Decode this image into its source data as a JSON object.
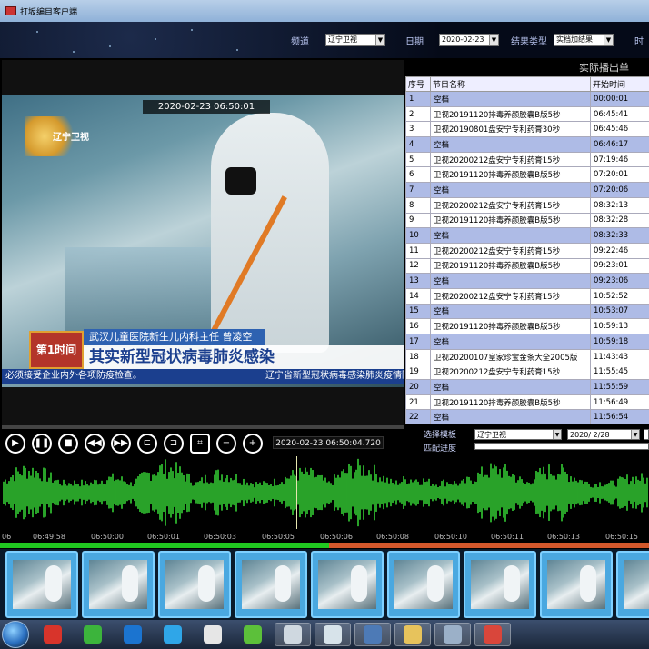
{
  "window": {
    "title": "打坂编目客户端"
  },
  "filters": {
    "channel_label": "频道",
    "channel_value": "辽宁卫视",
    "date_label": "日期",
    "date_value": "2020-02-23",
    "result_type_label": "结果类型",
    "result_type_value": "实档加结果",
    "time_label": "时"
  },
  "video": {
    "timestamp": "2020-02-23    06:50:01",
    "logo_text": "辽宁卫视",
    "badge_text": "第1时间",
    "name_bar": "武汉儿童医院新生儿内科主任  曾凌空",
    "headline": "其实新型冠状病毒肺炎感染",
    "ticker_left": "必须接受企业内外各项防疫检查。",
    "ticker_right": "辽宁省新型冠状病毒感染肺炎疫情防"
  },
  "controls": {
    "current_time": "2020-02-23  06:50:04.720",
    "buttons": [
      {
        "name": "play-button",
        "glyph": "▶"
      },
      {
        "name": "pause-button",
        "glyph": "❚❚"
      },
      {
        "name": "stop-button",
        "glyph": "■"
      },
      {
        "name": "rewind-button",
        "glyph": "◀◀"
      },
      {
        "name": "fast-forward-button",
        "glyph": "▶▶"
      },
      {
        "name": "mark-in-button",
        "glyph": "⊏"
      },
      {
        "name": "mark-out-button",
        "glyph": "⊐"
      },
      {
        "name": "crop-button",
        "glyph": "⌗"
      },
      {
        "name": "zoom-out-button",
        "glyph": "−"
      },
      {
        "name": "zoom-in-button",
        "glyph": "+"
      }
    ]
  },
  "playlist": {
    "title": "实际播出单",
    "headers": [
      "序号",
      "节目名称",
      "开始时间"
    ],
    "rows": [
      {
        "no": "1",
        "name": "空档",
        "start": "00:00:01",
        "blank": true
      },
      {
        "no": "2",
        "name": "卫视20191120排毒养颜胶囊B版5秒",
        "start": "06:45:41",
        "blank": false
      },
      {
        "no": "3",
        "name": "卫视20190801盘安宁专利药膏30秒",
        "start": "06:45:46",
        "blank": false
      },
      {
        "no": "4",
        "name": "空档",
        "start": "06:46:17",
        "blank": true
      },
      {
        "no": "5",
        "name": "卫视20200212盘安宁专利药膏15秒",
        "start": "07:19:46",
        "blank": false
      },
      {
        "no": "6",
        "name": "卫视20191120排毒养颜胶囊B版5秒",
        "start": "07:20:01",
        "blank": false
      },
      {
        "no": "7",
        "name": "空档",
        "start": "07:20:06",
        "blank": true
      },
      {
        "no": "8",
        "name": "卫视20200212盘安宁专利药膏15秒",
        "start": "08:32:13",
        "blank": false
      },
      {
        "no": "9",
        "name": "卫视20191120排毒养颜胶囊B版5秒",
        "start": "08:32:28",
        "blank": false
      },
      {
        "no": "10",
        "name": "空档",
        "start": "08:32:33",
        "blank": true
      },
      {
        "no": "11",
        "name": "卫视20200212盘安宁专利药膏15秒",
        "start": "09:22:46",
        "blank": false
      },
      {
        "no": "12",
        "name": "卫视20191120排毒养颜胶囊B版5秒",
        "start": "09:23:01",
        "blank": false
      },
      {
        "no": "13",
        "name": "空档",
        "start": "09:23:06",
        "blank": true
      },
      {
        "no": "14",
        "name": "卫视20200212盘安宁专利药膏15秒",
        "start": "10:52:52",
        "blank": false
      },
      {
        "no": "15",
        "name": "空档",
        "start": "10:53:07",
        "blank": true
      },
      {
        "no": "16",
        "name": "卫视20191120排毒养颜胶囊B版5秒",
        "start": "10:59:13",
        "blank": false
      },
      {
        "no": "17",
        "name": "空档",
        "start": "10:59:18",
        "blank": true
      },
      {
        "no": "18",
        "name": "卫视20200107皇家珍宝金条大全2005版",
        "start": "11:43:43",
        "blank": false
      },
      {
        "no": "19",
        "name": "卫视20200212盘安宁专利药膏15秒",
        "start": "11:55:45",
        "blank": false
      },
      {
        "no": "20",
        "name": "空档",
        "start": "11:55:59",
        "blank": true
      },
      {
        "no": "21",
        "name": "卫视20191120排毒养颜胶囊B版5秒",
        "start": "11:56:49",
        "blank": false
      },
      {
        "no": "22",
        "name": "空档",
        "start": "11:56:54",
        "blank": true
      }
    ]
  },
  "template_filter": {
    "select_label": "选择模板",
    "channel_value": "辽宁卫视",
    "date_value": "2020/ 2/28",
    "match_label": "匹配进度",
    "match_progress": 0
  },
  "timeline": {
    "ticks": [
      "06",
      "06:49:58",
      "06:50:00",
      "06:50:01",
      "06:50:03",
      "06:50:05",
      "06:50:06",
      "06:50:08",
      "06:50:10",
      "06:50:11",
      "06:50:13",
      "06:50:15"
    ],
    "progress_fraction": 0.507
  },
  "thumbnails_count": 9,
  "colors": {
    "wave": "#3be83b",
    "blank_row": "#aebbe6",
    "progress_done": "#20c820",
    "progress_rest": "#d2572b"
  },
  "taskbar": {
    "items": [
      {
        "name": "start-orb-icon",
        "color": "#2a6fc0"
      },
      {
        "name": "app-tiles-icon",
        "color": "#d8342b"
      },
      {
        "name": "network-icon",
        "color": "#3cb43c"
      },
      {
        "name": "teamviewer-icon",
        "color": "#1b74d0"
      },
      {
        "name": "internet-explorer-icon",
        "color": "#2fa6e8"
      },
      {
        "name": "chrome-icon",
        "color": "#e6e6e6"
      },
      {
        "name": "app-green-icon",
        "color": "#5cc03a"
      },
      {
        "name": "window-icon",
        "color": "#cfd8e0"
      },
      {
        "name": "document-icon",
        "color": "#d7e3ea"
      },
      {
        "name": "monitor-icon",
        "color": "#4d7ab6"
      },
      {
        "name": "folder-icon",
        "color": "#e7c35c"
      },
      {
        "name": "editor-icon",
        "color": "#9bb0c8"
      },
      {
        "name": "office-icon",
        "color": "#d9463b"
      }
    ]
  }
}
